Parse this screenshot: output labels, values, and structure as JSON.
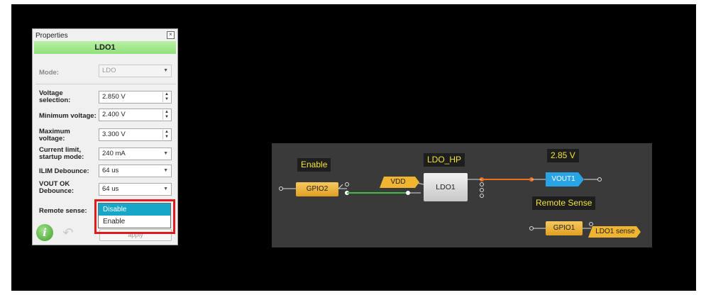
{
  "panel": {
    "title": "Properties",
    "close_glyph": "×",
    "header": "LDO1",
    "rows": [
      {
        "label": "Mode:",
        "value": "LDO"
      },
      {
        "label_line1": "Voltage",
        "label_line2": "selection:",
        "value": "2.850 V"
      },
      {
        "label": "Minimum voltage:",
        "value": "2.400 V"
      },
      {
        "label_line1": "Maximum",
        "label_line2": "voltage:",
        "value": "3.300 V"
      },
      {
        "label_line1": "Current limit,",
        "label_line2": "startup mode:",
        "value": "240 mA"
      },
      {
        "label": "ILIM Debounce:",
        "value": "64 us"
      },
      {
        "label_line1": "VOUT OK",
        "label_line2": "Debounce:",
        "value": "64 us"
      },
      {
        "label": "Remote sense:",
        "value": "Disable"
      }
    ],
    "dropdown_options": [
      "Disable",
      "Enable"
    ],
    "bottom_button_hint": "apply",
    "info_glyph": "i",
    "undo_glyph": "↶"
  },
  "schematic": {
    "labels": {
      "enable": "Enable",
      "ldo_hp": "LDO_HP",
      "vout_value": "2.85 V",
      "remote_sense": "Remote Sense"
    },
    "blocks": {
      "gpio2": "GPIO2",
      "vdd": "VDD",
      "ldo1": "LDO1",
      "vout1": "VOUT1",
      "gpio1": "GPIO1",
      "ldo1_sense": "LDO1 sense"
    },
    "colors": {
      "canvas": "#3a3a3a",
      "gpio": "#f0b430",
      "vout": "#28a4e6",
      "ldo_block": "#d9d9d9",
      "wire_green": "#3fbf3f",
      "wire_orange": "#e8701f",
      "label_text": "#f3e43a"
    }
  }
}
